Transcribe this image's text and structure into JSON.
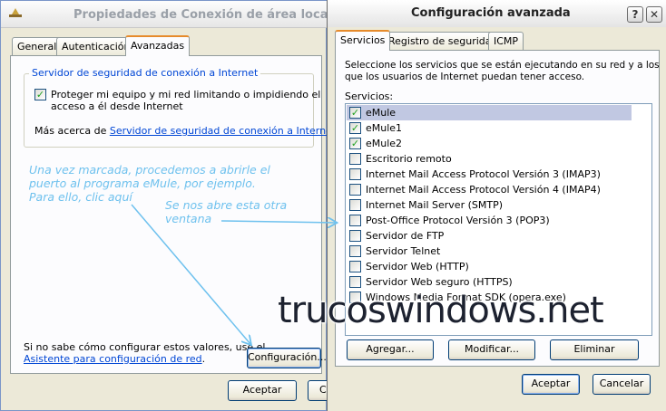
{
  "back_window": {
    "title": "Propiedades de Conexión de área local",
    "tabs": [
      "General",
      "Autenticación",
      "Avanzadas"
    ],
    "group_label": "Servidor de seguridad de conexión a Internet",
    "protect_label_line1": "Proteger mi equipo y mi red limitando o impidiendo el",
    "protect_label_line2": "acceso a él desde Internet",
    "more_about_prefix": "Más acerca de",
    "more_about_link": "Servidor de seguridad de conexión a Internet",
    "more_about_suffix": ".",
    "hint_line1": "Si no sabe cómo configurar estos valores, use el",
    "hint_link": "Asistente para configuración de red",
    "hint_suffix": ".",
    "config_button": "Configuración...",
    "ok_button": "Aceptar",
    "cancel_button_partial": "C"
  },
  "front_window": {
    "title": "Configuración avanzada",
    "help_button": "?",
    "close_button": "✕",
    "tabs": [
      "Servicios",
      "Registro de seguridad",
      "ICMP"
    ],
    "description_line1": "Seleccione los servicios que se están ejecutando en su red y a los",
    "description_line2": "que los usuarios de Internet puedan tener acceso.",
    "services_label": "Servicios:",
    "services": [
      {
        "label": "eMule",
        "checked": true,
        "selected": true
      },
      {
        "label": "eMule1",
        "checked": true,
        "selected": false
      },
      {
        "label": "eMule2",
        "checked": true,
        "selected": false
      },
      {
        "label": "Escritorio remoto",
        "checked": false,
        "selected": false
      },
      {
        "label": "Internet Mail Access Protocol Versión 3 (IMAP3)",
        "checked": false,
        "selected": false
      },
      {
        "label": "Internet Mail Access Protocol Versión 4 (IMAP4)",
        "checked": false,
        "selected": false
      },
      {
        "label": "Internet Mail Server (SMTP)",
        "checked": false,
        "selected": false
      },
      {
        "label": "Post-Office Protocol Versión 3 (POP3)",
        "checked": false,
        "selected": false
      },
      {
        "label": "Servidor de FTP",
        "checked": false,
        "selected": false
      },
      {
        "label": "Servidor Telnet",
        "checked": false,
        "selected": false
      },
      {
        "label": "Servidor Web (HTTP)",
        "checked": false,
        "selected": false
      },
      {
        "label": "Servidor Web seguro (HTTPS)",
        "checked": false,
        "selected": false
      },
      {
        "label": "Windows Media Format SDK (opera.exe)",
        "checked": false,
        "selected": false
      }
    ],
    "add_button": "Agregar...",
    "edit_button": "Modificar...",
    "delete_button": "Eliminar",
    "ok_button": "Aceptar",
    "cancel_button": "Cancelar"
  },
  "annotations": {
    "note1_line1": "Una vez marcada, procedemos a abrirle el",
    "note1_line2": "puerto al programa eMule, por ejemplo.",
    "note1_line3": "Para ello, clic aquí",
    "note2_line1": "Se nos abre esta otra",
    "note2_line2": "ventana",
    "color": "#6ec1ee"
  },
  "watermark": "trucoswindows.net"
}
